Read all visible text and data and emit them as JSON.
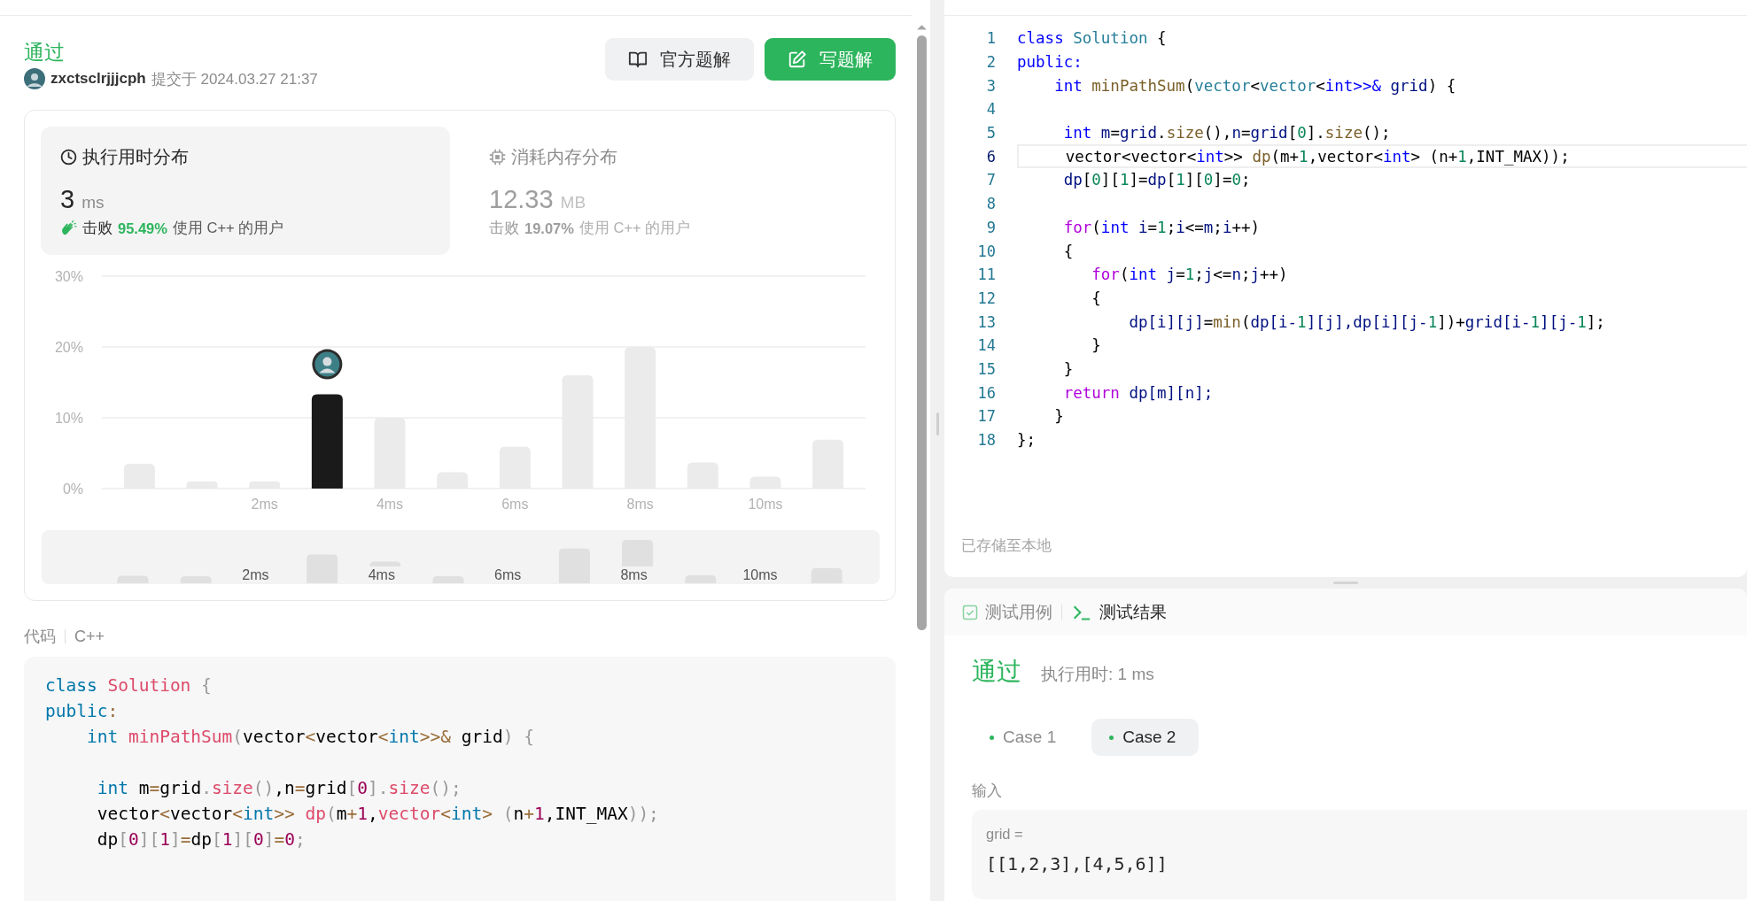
{
  "submission": {
    "status": "通过",
    "user": "zxctsclrjjjcph",
    "submitted": "提交于 2024.03.27 21:37",
    "buttons": [
      {
        "label": "官方题解",
        "kind": "secondary"
      },
      {
        "label": "写题解",
        "kind": "primary"
      }
    ]
  },
  "stats": [
    {
      "kind": "time",
      "title": "执行用时分布",
      "value": "3",
      "unit": "ms",
      "beats": "击败",
      "percent": "95.49%",
      "suffix": "使用 C++ 的用户",
      "selected": true
    },
    {
      "kind": "memory",
      "title": "消耗内存分布",
      "value": "12.33",
      "unit": "MB",
      "beats": "击败",
      "percent": "19.07%",
      "suffix": "使用 C++ 的用户",
      "selected": false
    }
  ],
  "chart_data": {
    "type": "bar",
    "x": [
      0,
      1,
      2,
      3,
      4,
      5,
      6,
      7,
      8,
      9,
      10,
      11
    ],
    "xlim": [
      -0.6,
      11.6
    ],
    "series": [
      {
        "color": "#ebebeb",
        "values": [
          3.5,
          1,
          1,
          null,
          10,
          2.3,
          5.9,
          16,
          20,
          3.7,
          1.7,
          6.9
        ]
      },
      {
        "color": "#1a1a1a",
        "values": [
          null,
          null,
          null,
          13.3,
          null,
          null,
          null,
          null,
          null,
          null,
          null,
          null
        ]
      }
    ],
    "ylim": [
      0,
      30
    ],
    "yticks": [
      {
        "value": 0,
        "label": "0%"
      },
      {
        "value": 10,
        "label": "10%"
      },
      {
        "value": 20,
        "label": "20%"
      },
      {
        "value": 30,
        "label": "30%"
      }
    ],
    "xticks": [
      {
        "value": 2,
        "label": "2ms"
      },
      {
        "value": 4,
        "label": "4ms"
      },
      {
        "value": 6,
        "label": "6ms"
      },
      {
        "value": 8,
        "label": "8ms"
      },
      {
        "value": 10,
        "label": "10ms"
      }
    ]
  },
  "navigator": {
    "labels": [
      "2ms",
      "4ms",
      "6ms",
      "8ms",
      "10ms"
    ]
  },
  "code_view": {
    "label": "代码",
    "language": "C++",
    "lines": [
      {
        "kind": "code",
        "tokens": [
          {
            "text": "class",
            "kind": "kw"
          },
          {
            "text": " Solution",
            "kind": "cls"
          },
          {
            "text": " {",
            "kind": "pu"
          }
        ]
      },
      {
        "kind": "code",
        "tokens": [
          {
            "text": "public",
            "kind": "kw"
          },
          {
            "text": ":",
            "kind": "op"
          }
        ]
      },
      {
        "kind": "code",
        "tokens": [
          {
            "text": "    int",
            "kind": "kw"
          },
          {
            "text": " minPathSum",
            "kind": "cls"
          },
          {
            "text": "(",
            "kind": "pu"
          },
          {
            "text": "vector",
            "kind": "p"
          },
          {
            "text": "<",
            "kind": "op"
          },
          {
            "text": "vector",
            "kind": "p"
          },
          {
            "text": "<",
            "kind": "op"
          },
          {
            "text": "int",
            "kind": "kw"
          },
          {
            "text": ">>&",
            "kind": "op"
          },
          {
            "text": " grid",
            "kind": "p"
          },
          {
            "text": ")",
            "kind": "pu"
          },
          {
            "text": " {",
            "kind": "pu"
          }
        ]
      },
      {
        "kind": "blank"
      },
      {
        "kind": "code",
        "tokens": [
          {
            "text": "     int",
            "kind": "kw"
          },
          {
            "text": " m",
            "kind": "p"
          },
          {
            "text": "=",
            "kind": "op"
          },
          {
            "text": "grid",
            "kind": "p"
          },
          {
            "text": ".",
            "kind": "pu"
          },
          {
            "text": "size",
            "kind": "cls"
          },
          {
            "text": "()",
            "kind": "pu"
          },
          {
            "text": ",n",
            "kind": "p"
          },
          {
            "text": "=",
            "kind": "op"
          },
          {
            "text": "grid",
            "kind": "p"
          },
          {
            "text": "[",
            "kind": "pu"
          },
          {
            "text": "0",
            "kind": "num"
          },
          {
            "text": "]",
            "kind": "pu"
          },
          {
            "text": ".",
            "kind": "pu"
          },
          {
            "text": "size",
            "kind": "cls"
          },
          {
            "text": "();",
            "kind": "pu"
          }
        ]
      },
      {
        "kind": "code",
        "tokens": [
          {
            "text": "     vector",
            "kind": "p"
          },
          {
            "text": "<",
            "kind": "op"
          },
          {
            "text": "vector",
            "kind": "p"
          },
          {
            "text": "<",
            "kind": "op"
          },
          {
            "text": "int",
            "kind": "kw"
          },
          {
            "text": ">>",
            "kind": "op"
          },
          {
            "text": " dp",
            "kind": "cls"
          },
          {
            "text": "(",
            "kind": "pu"
          },
          {
            "text": "m",
            "kind": "p"
          },
          {
            "text": "+",
            "kind": "op"
          },
          {
            "text": "1",
            "kind": "num"
          },
          {
            "text": ",",
            "kind": "p"
          },
          {
            "text": "vector",
            "kind": "cls"
          },
          {
            "text": "<",
            "kind": "op"
          },
          {
            "text": "int",
            "kind": "kw"
          },
          {
            "text": ">",
            "kind": "op"
          },
          {
            "text": " (",
            "kind": "pu"
          },
          {
            "text": "n",
            "kind": "p"
          },
          {
            "text": "+",
            "kind": "op"
          },
          {
            "text": "1",
            "kind": "num"
          },
          {
            "text": ",INT_MAX",
            "kind": "p"
          },
          {
            "text": "));",
            "kind": "pu"
          }
        ]
      },
      {
        "kind": "code",
        "tokens": [
          {
            "text": "     dp",
            "kind": "p"
          },
          {
            "text": "[",
            "kind": "pu"
          },
          {
            "text": "0",
            "kind": "num"
          },
          {
            "text": "][",
            "kind": "pu"
          },
          {
            "text": "1",
            "kind": "num"
          },
          {
            "text": "]",
            "kind": "pu"
          },
          {
            "text": "=",
            "kind": "op"
          },
          {
            "text": "dp",
            "kind": "p"
          },
          {
            "text": "[",
            "kind": "pu"
          },
          {
            "text": "1",
            "kind": "num"
          },
          {
            "text": "][",
            "kind": "pu"
          },
          {
            "text": "0",
            "kind": "num"
          },
          {
            "text": "]",
            "kind": "pu"
          },
          {
            "text": "=",
            "kind": "op"
          },
          {
            "text": "0",
            "kind": "num"
          },
          {
            "text": ";",
            "kind": "pu"
          }
        ]
      },
      {
        "kind": "blank"
      }
    ]
  },
  "editor": {
    "status": "已存储至本地",
    "lines": [
      {
        "number": "1",
        "active": false,
        "kind": "code",
        "tokens": [
          {
            "text": "class",
            "kind": "kw"
          },
          {
            "text": " Solution",
            "kind": "ty"
          },
          {
            "text": " {",
            "kind": "p"
          }
        ]
      },
      {
        "number": "2",
        "active": false,
        "kind": "code",
        "tokens": [
          {
            "text": "public:",
            "kind": "kw"
          }
        ]
      },
      {
        "number": "3",
        "active": false,
        "kind": "code",
        "tokens": [
          {
            "text": "    int",
            "kind": "kw"
          },
          {
            "text": " minPathSum",
            "kind": "fn"
          },
          {
            "text": "(",
            "kind": "p"
          },
          {
            "text": "vector",
            "kind": "ty"
          },
          {
            "text": "<",
            "kind": "p"
          },
          {
            "text": "vector",
            "kind": "ty"
          },
          {
            "text": "<",
            "kind": "p"
          },
          {
            "text": "int",
            "kind": "kw"
          },
          {
            "text": ">>&",
            "kind": "kw"
          },
          {
            "text": " grid",
            "kind": "var"
          },
          {
            "text": ") {",
            "kind": "p"
          }
        ]
      },
      {
        "number": "4",
        "active": false,
        "kind": "blank"
      },
      {
        "number": "5",
        "active": false,
        "kind": "code",
        "tokens": [
          {
            "text": "     int",
            "kind": "kw"
          },
          {
            "text": " m",
            "kind": "var"
          },
          {
            "text": "=",
            "kind": "p"
          },
          {
            "text": "grid",
            "kind": "var"
          },
          {
            "text": ".",
            "kind": "p"
          },
          {
            "text": "size",
            "kind": "fn"
          },
          {
            "text": "(),",
            "kind": "p"
          },
          {
            "text": "n",
            "kind": "var"
          },
          {
            "text": "=",
            "kind": "p"
          },
          {
            "text": "grid",
            "kind": "var"
          },
          {
            "text": "[",
            "kind": "p"
          },
          {
            "text": "0",
            "kind": "num"
          },
          {
            "text": "].",
            "kind": "p"
          },
          {
            "text": "size",
            "kind": "fn"
          },
          {
            "text": "();",
            "kind": "p"
          }
        ]
      },
      {
        "number": "6",
        "active": true,
        "kind": "code",
        "tokens": [
          {
            "text": "     vector<vector<",
            "kind": "p"
          },
          {
            "text": "int",
            "kind": "kw"
          },
          {
            "text": ">> ",
            "kind": "p"
          },
          {
            "text": "dp",
            "kind": "fn"
          },
          {
            "text": "(m+",
            "kind": "p"
          },
          {
            "text": "1",
            "kind": "num"
          },
          {
            "text": ",vector<",
            "kind": "p"
          },
          {
            "text": "int",
            "kind": "kw"
          },
          {
            "text": "> (n+",
            "kind": "p"
          },
          {
            "text": "1",
            "kind": "num"
          },
          {
            "text": ",INT_MAX));",
            "kind": "p"
          }
        ]
      },
      {
        "number": "7",
        "active": false,
        "kind": "code",
        "tokens": [
          {
            "text": "     dp",
            "kind": "var"
          },
          {
            "text": "[",
            "kind": "p"
          },
          {
            "text": "0",
            "kind": "num"
          },
          {
            "text": "][",
            "kind": "p"
          },
          {
            "text": "1",
            "kind": "num"
          },
          {
            "text": "]=",
            "kind": "p"
          },
          {
            "text": "dp",
            "kind": "var"
          },
          {
            "text": "[",
            "kind": "p"
          },
          {
            "text": "1",
            "kind": "num"
          },
          {
            "text": "][",
            "kind": "p"
          },
          {
            "text": "0",
            "kind": "num"
          },
          {
            "text": "]=",
            "kind": "p"
          },
          {
            "text": "0",
            "kind": "num"
          },
          {
            "text": ";",
            "kind": "p"
          }
        ]
      },
      {
        "number": "8",
        "active": false,
        "kind": "blank"
      },
      {
        "number": "9",
        "active": false,
        "kind": "code",
        "tokens": [
          {
            "text": "     for",
            "kind": "ctl"
          },
          {
            "text": "(",
            "kind": "p"
          },
          {
            "text": "int",
            "kind": "kw"
          },
          {
            "text": " i",
            "kind": "var"
          },
          {
            "text": "=",
            "kind": "p"
          },
          {
            "text": "1",
            "kind": "num"
          },
          {
            "text": ";",
            "kind": "p"
          },
          {
            "text": "i",
            "kind": "var"
          },
          {
            "text": "<=",
            "kind": "p"
          },
          {
            "text": "m",
            "kind": "var"
          },
          {
            "text": ";",
            "kind": "p"
          },
          {
            "text": "i",
            "kind": "var"
          },
          {
            "text": "++)",
            "kind": "p"
          }
        ]
      },
      {
        "number": "10",
        "active": false,
        "kind": "code",
        "tokens": [
          {
            "text": "     {",
            "kind": "p"
          }
        ]
      },
      {
        "number": "11",
        "active": false,
        "kind": "code",
        "tokens": [
          {
            "text": "        for",
            "kind": "ctl"
          },
          {
            "text": "(",
            "kind": "p"
          },
          {
            "text": "int",
            "kind": "kw"
          },
          {
            "text": " j",
            "kind": "var"
          },
          {
            "text": "=",
            "kind": "p"
          },
          {
            "text": "1",
            "kind": "num"
          },
          {
            "text": ";",
            "kind": "p"
          },
          {
            "text": "j",
            "kind": "var"
          },
          {
            "text": "<=",
            "kind": "p"
          },
          {
            "text": "n",
            "kind": "var"
          },
          {
            "text": ";",
            "kind": "p"
          },
          {
            "text": "j",
            "kind": "var"
          },
          {
            "text": "++)",
            "kind": "p"
          }
        ]
      },
      {
        "number": "12",
        "active": false,
        "kind": "code",
        "tokens": [
          {
            "text": "        {",
            "kind": "p"
          }
        ]
      },
      {
        "number": "13",
        "active": false,
        "kind": "code",
        "tokens": [
          {
            "text": "            dp[i][j]",
            "kind": "var"
          },
          {
            "text": "=",
            "kind": "p"
          },
          {
            "text": "min",
            "kind": "fn"
          },
          {
            "text": "(",
            "kind": "p"
          },
          {
            "text": "dp[i-",
            "kind": "var"
          },
          {
            "text": "1",
            "kind": "num"
          },
          {
            "text": "][j],dp[i][j-",
            "kind": "var"
          },
          {
            "text": "1",
            "kind": "num"
          },
          {
            "text": "])+",
            "kind": "p"
          },
          {
            "text": "grid[i-",
            "kind": "var"
          },
          {
            "text": "1",
            "kind": "num"
          },
          {
            "text": "][j-",
            "kind": "var"
          },
          {
            "text": "1",
            "kind": "num"
          },
          {
            "text": "];",
            "kind": "p"
          }
        ]
      },
      {
        "number": "14",
        "active": false,
        "kind": "code",
        "tokens": [
          {
            "text": "        }",
            "kind": "p"
          }
        ]
      },
      {
        "number": "15",
        "active": false,
        "kind": "code",
        "tokens": [
          {
            "text": "     }",
            "kind": "p"
          }
        ]
      },
      {
        "number": "16",
        "active": false,
        "kind": "code",
        "tokens": [
          {
            "text": "     return",
            "kind": "ctl"
          },
          {
            "text": " dp[m][n];",
            "kind": "var"
          }
        ]
      },
      {
        "number": "17",
        "active": false,
        "kind": "code",
        "tokens": [
          {
            "text": "    }",
            "kind": "p"
          }
        ]
      },
      {
        "number": "18",
        "active": false,
        "kind": "code",
        "tokens": [
          {
            "text": "};",
            "kind": "p"
          }
        ]
      }
    ]
  },
  "result": {
    "tabs": [
      {
        "kind": "cases",
        "label": "测试用例",
        "selected": false
      },
      {
        "kind": "results",
        "label": "测试结果",
        "selected": true
      }
    ],
    "status": "通过",
    "runtime": "执行用时: 1 ms",
    "cases": [
      {
        "label": "Case 1",
        "selected": false
      },
      {
        "label": "Case 2",
        "selected": true
      }
    ],
    "input_label": "输入",
    "inputs": [
      {
        "name": "grid =",
        "value": "[[1,2,3],[4,5,6]]"
      }
    ]
  }
}
